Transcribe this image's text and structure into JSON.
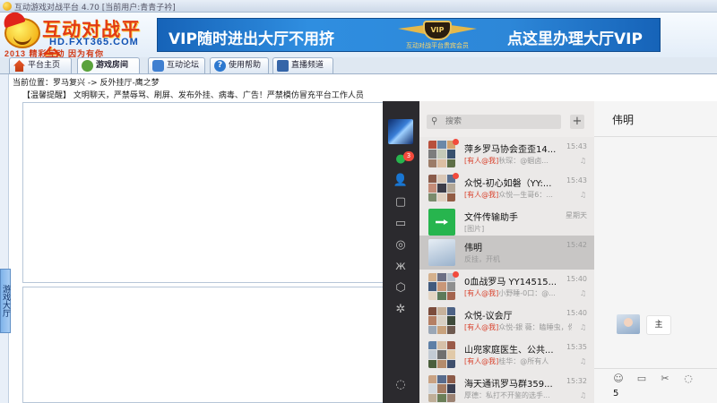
{
  "window": {
    "title": "互动游戏对战平台 4.70 [当前用户:青青子衿]"
  },
  "header": {
    "logo_name": "互动对战平台",
    "logo_url": "HD.FXT365.COM",
    "logo_slogan": "2013 精彩互动 因为有你",
    "banner_left": "VIP随时进出大厅不用挤",
    "banner_right": "点这里办理大厅VIP",
    "banner_badge_label": "互动对战平台贵宾会员",
    "banner_badge_text": "VIP"
  },
  "tabs": [
    {
      "label": "平台主页",
      "icon": "home-icon"
    },
    {
      "label": "游戏房间",
      "icon": "gamepad-icon"
    },
    {
      "label": "互动论坛",
      "icon": "forum-icon"
    },
    {
      "label": "使用帮助",
      "icon": "help-icon"
    },
    {
      "label": "直播频道",
      "icon": "tv-icon"
    }
  ],
  "breadcrumb": "当前位置：罗马复兴 -> 反外挂厅-鹰之梦",
  "notice": "【温馨提醒】 文明聊天，严禁辱骂、刷屏、发布外挂、病毒、广告！严禁模仿冒充平台工作人员",
  "side_tab": "游戏大厅",
  "wechat": {
    "search_placeholder": "搜索",
    "add_label": "+",
    "unread_badge": "3",
    "conversations": [
      {
        "name": "萍乡罗马协会歪歪14...",
        "time": "15:43",
        "at": "[有人@我]",
        "preview": "秋琛：@蝈卤...",
        "avatar": "grid"
      },
      {
        "name": "众悦-初心如磐（YY:...",
        "time": "15:43",
        "at": "[有人@我]",
        "preview": "众悦—生哥6：...",
        "avatar": "grid"
      },
      {
        "name": "文件传输助手",
        "time": "星期天",
        "at": "",
        "preview": "[图片]",
        "avatar": "file"
      },
      {
        "name": "伟明",
        "time": "15:42",
        "at": "",
        "preview": "反挂，开机",
        "avatar": "person"
      },
      {
        "name": "0血战罗马 YY14515...",
        "time": "15:40",
        "at": "[有人@我]",
        "preview": "小野睡-0口：@...",
        "avatar": "grid"
      },
      {
        "name": "众悦-议会厅",
        "time": "15:40",
        "at": "[有人@我]",
        "preview": "众悦-銀 薇：瞌睡虫，你...",
        "avatar": "grid"
      },
      {
        "name": "山兜家庭医生、公共...",
        "time": "15:35",
        "at": "[有人@我]",
        "preview": "桂华：@所有人",
        "avatar": "grid"
      },
      {
        "name": "海天通讯罗马群359...",
        "time": "15:32",
        "at": "",
        "preview": "厚德：私打不开鉴的选手...",
        "avatar": "grid"
      }
    ],
    "chat": {
      "title": "伟明",
      "message": "主",
      "input": "5"
    }
  },
  "colors": {
    "accent_green": "#27b54e",
    "badge_red": "#f24a3c",
    "banner_blue": "#2d87d8"
  }
}
